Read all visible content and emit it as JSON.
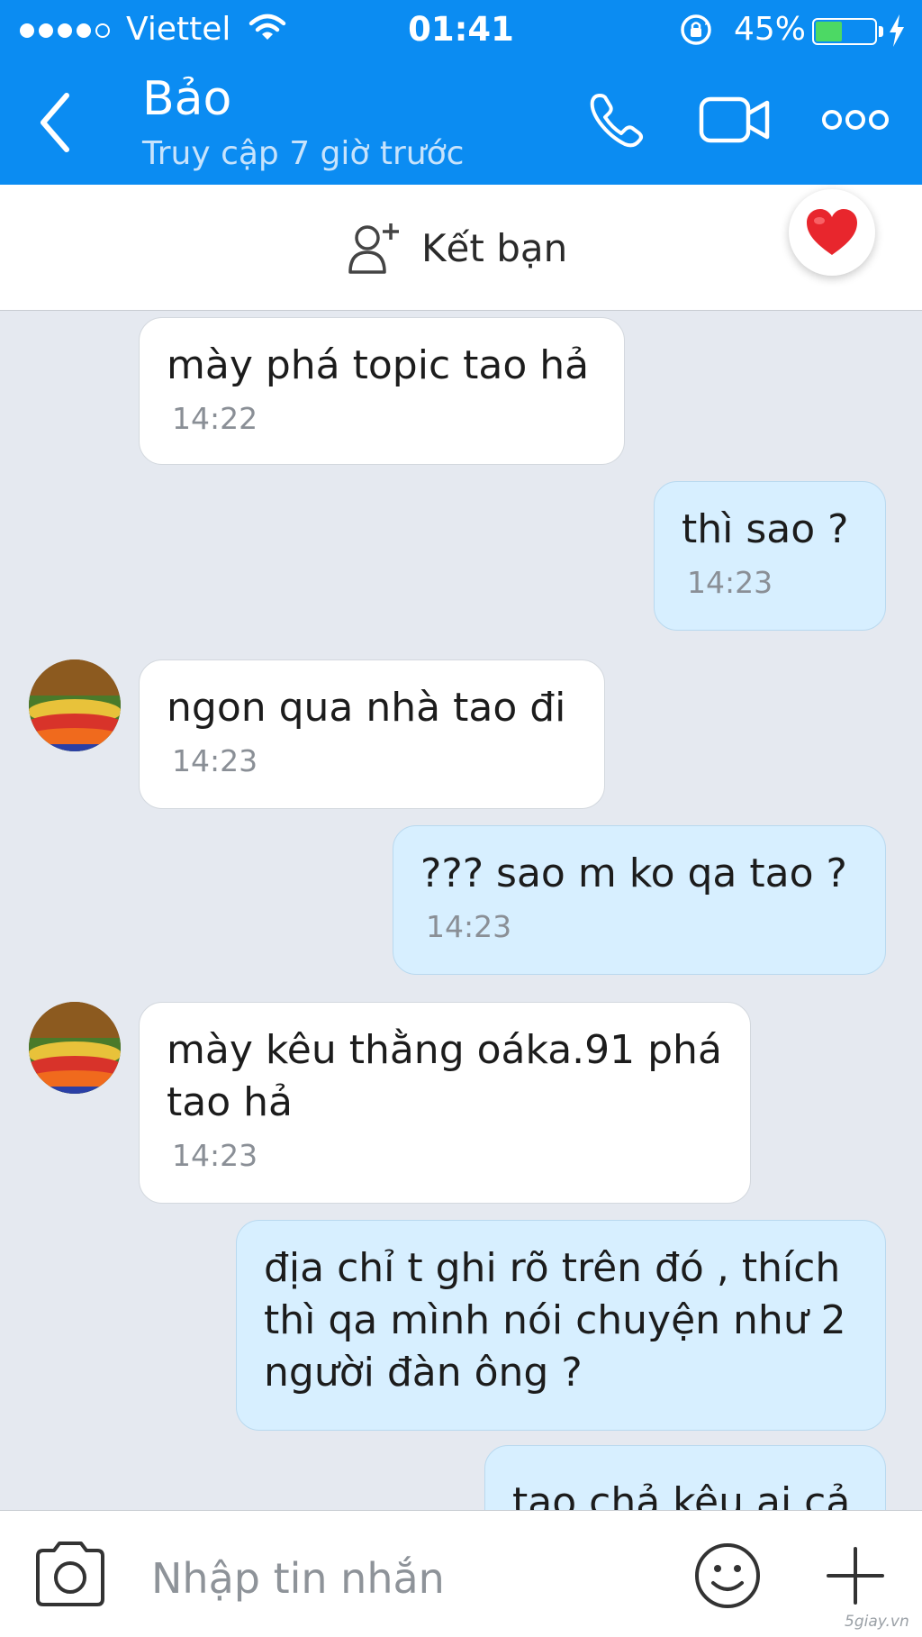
{
  "status_bar": {
    "carrier": "Viettel",
    "time": "01:41",
    "battery_percent": "45%",
    "battery_level": 0.45,
    "signal_bars_filled": 4,
    "signal_bars_total": 5
  },
  "header": {
    "title": "Bảo",
    "subtitle": "Truy cập 7 giờ trước",
    "background_color": "#0b8cf2"
  },
  "friend_bar": {
    "add_friend_label": "Kết bạn"
  },
  "messages": [
    {
      "direction": "incoming",
      "text": "mày phá topic tao hả",
      "time": "14:22",
      "avatar": false
    },
    {
      "direction": "outgoing",
      "text": "thì sao ?",
      "time": "14:23"
    },
    {
      "direction": "incoming",
      "text": "ngon qua nhà tao đi",
      "time": "14:23",
      "avatar": true
    },
    {
      "direction": "outgoing",
      "text": "??? sao m ko qa tao ?",
      "time": "14:23"
    },
    {
      "direction": "incoming",
      "text": "mày kêu thằng oáka.91 phá\ntao hả",
      "time": "14:23",
      "avatar": true
    },
    {
      "direction": "outgoing",
      "text": "địa chỉ t ghi rõ trên đó , thích\nthì qa mình nói chuyện như 2\nngười đàn ông ?",
      "time": ""
    },
    {
      "direction": "outgoing",
      "text": "tao chả kêu ai cả",
      "time": ""
    }
  ],
  "input_bar": {
    "placeholder": "Nhập tin nhắn",
    "value": ""
  },
  "watermark": "5giay.vn",
  "icons": {
    "back": "chevron-left-icon",
    "call": "phone-icon",
    "video": "video-camera-icon",
    "more": "more-dots-icon",
    "add_friend": "add-user-icon",
    "heart": "heart-icon",
    "camera": "camera-icon",
    "emoji": "smiley-icon",
    "plus": "plus-icon"
  },
  "colors": {
    "incoming_bubble": "#ffffff",
    "outgoing_bubble": "#d7efff",
    "chat_background": "#e5e9f0",
    "heart": "#e8262d",
    "battery_fill": "#4cd964"
  }
}
